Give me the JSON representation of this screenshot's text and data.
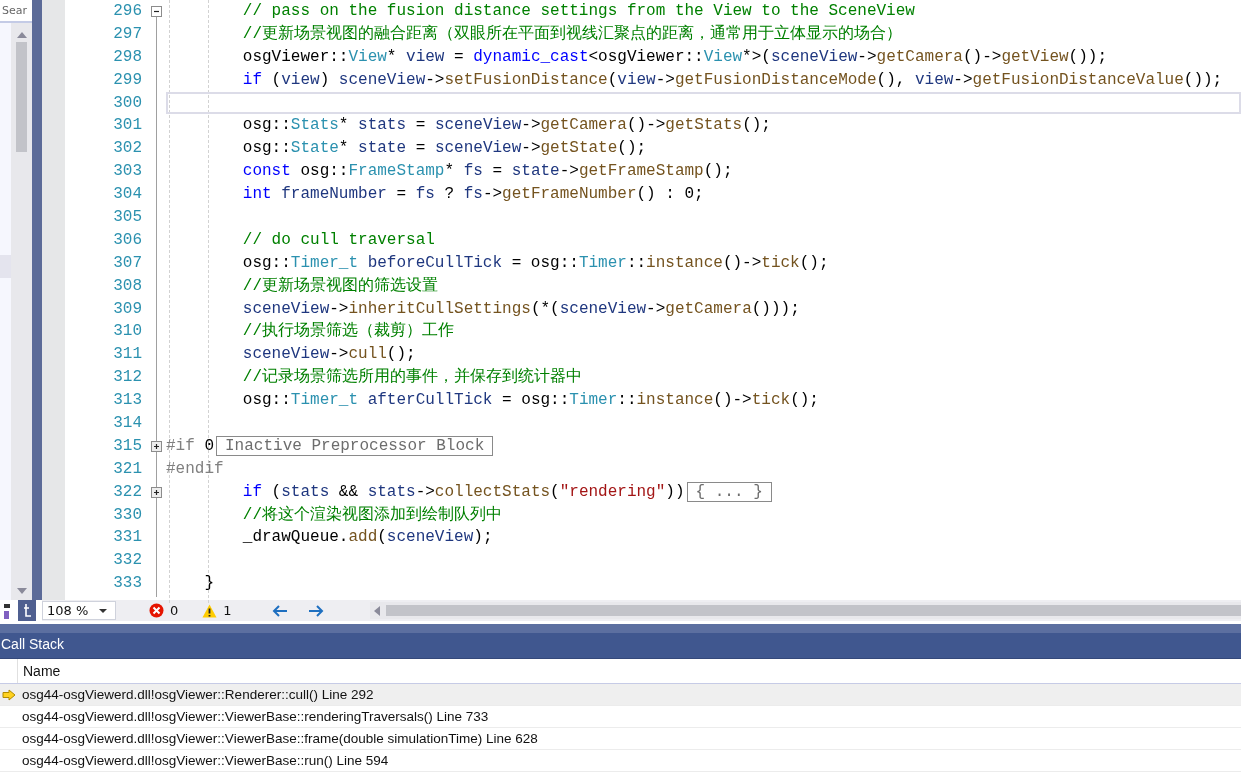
{
  "side_panel": {
    "search": {
      "value": "Sear"
    }
  },
  "editor": {
    "lines": [
      {
        "number": "296",
        "fold": {
          "expanded": true
        },
        "current": false,
        "tokens": [
          {
            "kind": "comment",
            "text": "        // pass on the fusion distance settings from the View to the SceneView"
          }
        ]
      },
      {
        "number": "297",
        "current": false,
        "tokens": [
          {
            "kind": "comment",
            "text": "        //更新场景视图的融合距离（双眼所在平面到视线汇聚点的距离，通常用于立体显示的场合）"
          }
        ]
      },
      {
        "number": "298",
        "current": false,
        "tokens": [
          {
            "kind": "plain",
            "text": "        osgViewer::"
          },
          {
            "kind": "type",
            "text": "View"
          },
          {
            "kind": "plain",
            "text": "* "
          },
          {
            "kind": "var",
            "text": "view"
          },
          {
            "kind": "plain",
            "text": " = "
          },
          {
            "kind": "keyword",
            "text": "dynamic_cast"
          },
          {
            "kind": "plain",
            "text": "<osgViewer::"
          },
          {
            "kind": "type",
            "text": "View"
          },
          {
            "kind": "plain",
            "text": "*>("
          },
          {
            "kind": "var",
            "text": "sceneView"
          },
          {
            "kind": "plain",
            "text": "->"
          },
          {
            "kind": "func",
            "text": "getCamera"
          },
          {
            "kind": "plain",
            "text": "()->"
          },
          {
            "kind": "func",
            "text": "getView"
          },
          {
            "kind": "plain",
            "text": "());"
          }
        ]
      },
      {
        "number": "299",
        "current": false,
        "tokens": [
          {
            "kind": "keyword",
            "text": "        if"
          },
          {
            "kind": "plain",
            "text": " ("
          },
          {
            "kind": "var",
            "text": "view"
          },
          {
            "kind": "plain",
            "text": ") "
          },
          {
            "kind": "var",
            "text": "sceneView"
          },
          {
            "kind": "plain",
            "text": "->"
          },
          {
            "kind": "func",
            "text": "setFusionDistance"
          },
          {
            "kind": "plain",
            "text": "("
          },
          {
            "kind": "var",
            "text": "view"
          },
          {
            "kind": "plain",
            "text": "->"
          },
          {
            "kind": "func",
            "text": "getFusionDistanceMode"
          },
          {
            "kind": "plain",
            "text": "(), "
          },
          {
            "kind": "var",
            "text": "view"
          },
          {
            "kind": "plain",
            "text": "->"
          },
          {
            "kind": "func",
            "text": "getFusionDistanceValue"
          },
          {
            "kind": "plain",
            "text": "());"
          }
        ]
      },
      {
        "number": "300",
        "current": true
      },
      {
        "number": "301",
        "current": false,
        "tokens": [
          {
            "kind": "plain",
            "text": "        osg::"
          },
          {
            "kind": "type",
            "text": "Stats"
          },
          {
            "kind": "plain",
            "text": "* "
          },
          {
            "kind": "var",
            "text": "stats"
          },
          {
            "kind": "plain",
            "text": " = "
          },
          {
            "kind": "var",
            "text": "sceneView"
          },
          {
            "kind": "plain",
            "text": "->"
          },
          {
            "kind": "func",
            "text": "getCamera"
          },
          {
            "kind": "plain",
            "text": "()->"
          },
          {
            "kind": "func",
            "text": "getStats"
          },
          {
            "kind": "plain",
            "text": "();"
          }
        ]
      },
      {
        "number": "302",
        "current": false,
        "tokens": [
          {
            "kind": "plain",
            "text": "        osg::"
          },
          {
            "kind": "type",
            "text": "State"
          },
          {
            "kind": "plain",
            "text": "* "
          },
          {
            "kind": "var",
            "text": "state"
          },
          {
            "kind": "plain",
            "text": " = "
          },
          {
            "kind": "var",
            "text": "sceneView"
          },
          {
            "kind": "plain",
            "text": "->"
          },
          {
            "kind": "func",
            "text": "getState"
          },
          {
            "kind": "plain",
            "text": "();"
          }
        ]
      },
      {
        "number": "303",
        "current": false,
        "tokens": [
          {
            "kind": "keyword",
            "text": "        const"
          },
          {
            "kind": "plain",
            "text": " osg::"
          },
          {
            "kind": "type",
            "text": "FrameStamp"
          },
          {
            "kind": "plain",
            "text": "* "
          },
          {
            "kind": "var",
            "text": "fs"
          },
          {
            "kind": "plain",
            "text": " = "
          },
          {
            "kind": "var",
            "text": "state"
          },
          {
            "kind": "plain",
            "text": "->"
          },
          {
            "kind": "func",
            "text": "getFrameStamp"
          },
          {
            "kind": "plain",
            "text": "();"
          }
        ]
      },
      {
        "number": "304",
        "current": false,
        "tokens": [
          {
            "kind": "keyword",
            "text": "        int "
          },
          {
            "kind": "var",
            "text": "frameNumber"
          },
          {
            "kind": "plain",
            "text": " = "
          },
          {
            "kind": "var",
            "text": "fs"
          },
          {
            "kind": "plain",
            "text": " ? "
          },
          {
            "kind": "var",
            "text": "fs"
          },
          {
            "kind": "plain",
            "text": "->"
          },
          {
            "kind": "func",
            "text": "getFrameNumber"
          },
          {
            "kind": "plain",
            "text": "() : 0;"
          }
        ]
      },
      {
        "number": "305",
        "current": false
      },
      {
        "number": "306",
        "current": false,
        "tokens": [
          {
            "kind": "comment",
            "text": "        // do cull traversal"
          }
        ]
      },
      {
        "number": "307",
        "current": false,
        "tokens": [
          {
            "kind": "plain",
            "text": "        osg::"
          },
          {
            "kind": "type",
            "text": "Timer_t "
          },
          {
            "kind": "var",
            "text": "beforeCullTick"
          },
          {
            "kind": "plain",
            "text": " = osg::"
          },
          {
            "kind": "type",
            "text": "Timer"
          },
          {
            "kind": "plain",
            "text": "::"
          },
          {
            "kind": "func",
            "text": "instance"
          },
          {
            "kind": "plain",
            "text": "()->"
          },
          {
            "kind": "func",
            "text": "tick"
          },
          {
            "kind": "plain",
            "text": "();"
          }
        ]
      },
      {
        "number": "308",
        "current": false,
        "tokens": [
          {
            "kind": "comment",
            "text": "        //更新场景视图的筛选设置"
          }
        ]
      },
      {
        "number": "309",
        "current": false,
        "tokens": [
          {
            "kind": "var",
            "text": "        sceneView"
          },
          {
            "kind": "plain",
            "text": "->"
          },
          {
            "kind": "func",
            "text": "inheritCullSettings"
          },
          {
            "kind": "plain",
            "text": "(*("
          },
          {
            "kind": "var",
            "text": "sceneView"
          },
          {
            "kind": "plain",
            "text": "->"
          },
          {
            "kind": "func",
            "text": "getCamera"
          },
          {
            "kind": "plain",
            "text": "()));"
          }
        ]
      },
      {
        "number": "310",
        "current": false,
        "tokens": [
          {
            "kind": "comment",
            "text": "        //执行场景筛选（裁剪）工作"
          }
        ]
      },
      {
        "number": "311",
        "current": false,
        "tokens": [
          {
            "kind": "var",
            "text": "        sceneView"
          },
          {
            "kind": "plain",
            "text": "->"
          },
          {
            "kind": "func",
            "text": "cull"
          },
          {
            "kind": "plain",
            "text": "();"
          }
        ]
      },
      {
        "number": "312",
        "current": false,
        "tokens": [
          {
            "kind": "comment",
            "text": "        //记录场景筛选所用的事件，并保存到统计器中"
          }
        ]
      },
      {
        "number": "313",
        "current": false,
        "tokens": [
          {
            "kind": "plain",
            "text": "        osg::"
          },
          {
            "kind": "type",
            "text": "Timer_t "
          },
          {
            "kind": "var",
            "text": "afterCullTick"
          },
          {
            "kind": "plain",
            "text": " = osg::"
          },
          {
            "kind": "type",
            "text": "Timer"
          },
          {
            "kind": "plain",
            "text": "::"
          },
          {
            "kind": "func",
            "text": "instance"
          },
          {
            "kind": "plain",
            "text": "()->"
          },
          {
            "kind": "func",
            "text": "tick"
          },
          {
            "kind": "plain",
            "text": "();"
          }
        ]
      },
      {
        "number": "314",
        "current": false
      },
      {
        "number": "315",
        "fold": {
          "expanded": false
        },
        "current": false,
        "tokens": [
          {
            "kind": "preproc",
            "text": "#if "
          },
          {
            "kind": "plain",
            "text": "0"
          }
        ],
        "collapsed": "Inactive Preprocessor Block"
      },
      {
        "number": "321",
        "current": false,
        "tokens": [
          {
            "kind": "preproc",
            "text": "#endif"
          }
        ]
      },
      {
        "number": "322",
        "fold": {
          "expanded": false
        },
        "current": false,
        "tokens": [
          {
            "kind": "keyword",
            "text": "        if"
          },
          {
            "kind": "plain",
            "text": " ("
          },
          {
            "kind": "var",
            "text": "stats"
          },
          {
            "kind": "plain",
            "text": " && "
          },
          {
            "kind": "var",
            "text": "stats"
          },
          {
            "kind": "plain",
            "text": "->"
          },
          {
            "kind": "func",
            "text": "collectStats"
          },
          {
            "kind": "plain",
            "text": "("
          },
          {
            "kind": "string",
            "text": "\"rendering\""
          },
          {
            "kind": "plain",
            "text": "))"
          }
        ],
        "collapsed": "{ ... }"
      },
      {
        "number": "330",
        "current": false,
        "tokens": [
          {
            "kind": "comment",
            "text": "        //将这个渲染视图添加到绘制队列中"
          }
        ]
      },
      {
        "number": "331",
        "current": false,
        "tokens": [
          {
            "kind": "plain",
            "text": "        _drawQueue."
          },
          {
            "kind": "func",
            "text": "add"
          },
          {
            "kind": "plain",
            "text": "("
          },
          {
            "kind": "var",
            "text": "sceneView"
          },
          {
            "kind": "plain",
            "text": ");"
          }
        ]
      },
      {
        "number": "332",
        "current": false
      },
      {
        "number": "333",
        "current": false,
        "tokens": [
          {
            "kind": "plain",
            "text": "    }"
          }
        ]
      }
    ]
  },
  "status_bar": {
    "zoom": "108 %",
    "errors": "0",
    "warnings": "1"
  },
  "call_stack": {
    "title": "Call Stack",
    "columns": [
      "Name"
    ],
    "rows": [
      {
        "name": "osg44-osgViewerd.dll!osgViewer::Renderer::cull() Line 292",
        "current": true
      },
      {
        "name": "osg44-osgViewerd.dll!osgViewer::ViewerBase::renderingTraversals() Line 733",
        "current": false
      },
      {
        "name": "osg44-osgViewerd.dll!osgViewer::ViewerBase::frame(double simulationTime) Line 628",
        "current": false
      },
      {
        "name": "osg44-osgViewerd.dll!osgViewer::ViewerBase::run() Line 594",
        "current": false
      }
    ]
  }
}
